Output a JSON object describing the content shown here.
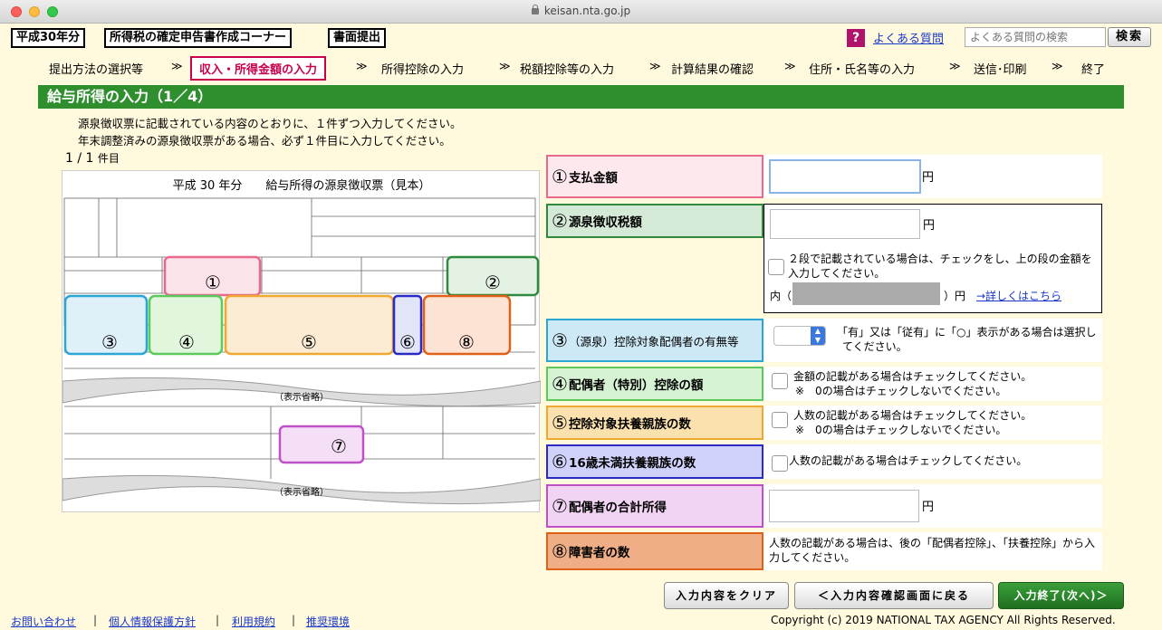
{
  "browser": {
    "url": "keisan.nta.go.jp"
  },
  "header": {
    "year": "平成30年分",
    "corner": "所得税の確定申告書作成コーナー",
    "mode": "書面提出",
    "faq_icon": "?",
    "faq_link": "よくある質問",
    "search_placeholder": "よくある質問の検索",
    "search_button": "検索"
  },
  "steps": [
    {
      "label": "提出方法の選択等"
    },
    {
      "label": "収入・所得金額の入力"
    },
    {
      "label": "所得控除の入力"
    },
    {
      "label": "税額控除等の入力"
    },
    {
      "label": "計算結果の確認"
    },
    {
      "label": "住所・氏名等の入力"
    },
    {
      "label": "送信･印刷"
    },
    {
      "label": "終了"
    }
  ],
  "step_arrow": "≫",
  "page_title": "給与所得の入力（1／4）",
  "notes": [
    "源泉徴収票に記載されている内容のとおりに、１件ずつ入力してください。",
    "年末調整済みの源泉徴収票がある場合、必ず１件目に入力してください。"
  ],
  "counter": {
    "value": "1 / 1",
    "unit": "件目"
  },
  "slip": {
    "title": "平成 30 年分　　給与所得の源泉徴収票（見本）",
    "omitted": "（表示省略）",
    "marks": [
      "①",
      "②",
      "③",
      "④",
      "⑤",
      "⑥",
      "⑦",
      "⑧"
    ]
  },
  "fields": [
    {
      "num": "①",
      "label": "支払金額",
      "unit": "円",
      "value": ""
    },
    {
      "num": "②",
      "label": "源泉徴収税額",
      "unit": "円",
      "value": "",
      "note": "２段で記載されている場合は、チェックをし、上の段の金額を入力してください。",
      "inner_prefix": "内（",
      "inner_suffix": "）円",
      "detail_link": "→詳しくはこちら"
    },
    {
      "num": "③",
      "label": "（源泉）控除対象配偶者の有無等",
      "note": "「有」又は「従有」に「○」表示がある場合は選択してください。"
    },
    {
      "num": "④",
      "label": "配偶者（特別）控除の額",
      "note1": "金額の記載がある場合はチェックしてください。",
      "note2": "※　0の場合はチェックしないでください。"
    },
    {
      "num": "⑤",
      "label": "控除対象扶養親族の数",
      "note1": "人数の記載がある場合はチェックしてください。",
      "note2": "※　0の場合はチェックしないでください。"
    },
    {
      "num": "⑥",
      "label": "16歳未満扶養親族の数",
      "note1": "人数の記載がある場合はチェックしてください。"
    },
    {
      "num": "⑦",
      "label": "配偶者の合計所得",
      "unit": "円",
      "value": ""
    },
    {
      "num": "⑧",
      "label": "障害者の数",
      "note1": "人数の記載がある場合は、後の「配偶者控除」、「扶養控除」から入力してください。"
    }
  ],
  "colors": {
    "f1": "#e8698a",
    "f2": "#2e8a3c",
    "f3": "#2aa6d6",
    "f4": "#5acb5a",
    "f5": "#f0a830",
    "f6": "#2a2ac8",
    "f7": "#c050c8",
    "f8": "#e06018"
  },
  "buttons": {
    "clear": "入力内容をクリア",
    "back": "＜入力内容確認画面に戻る",
    "next": "入力終了(次へ)＞"
  },
  "footer": {
    "links": [
      "お問い合わせ",
      "個人情報保護方針",
      "利用規約",
      "推奨環境"
    ],
    "separator": "|",
    "copyright": "Copyright (c) 2019 NATIONAL TAX AGENCY All Rights Reserved."
  }
}
